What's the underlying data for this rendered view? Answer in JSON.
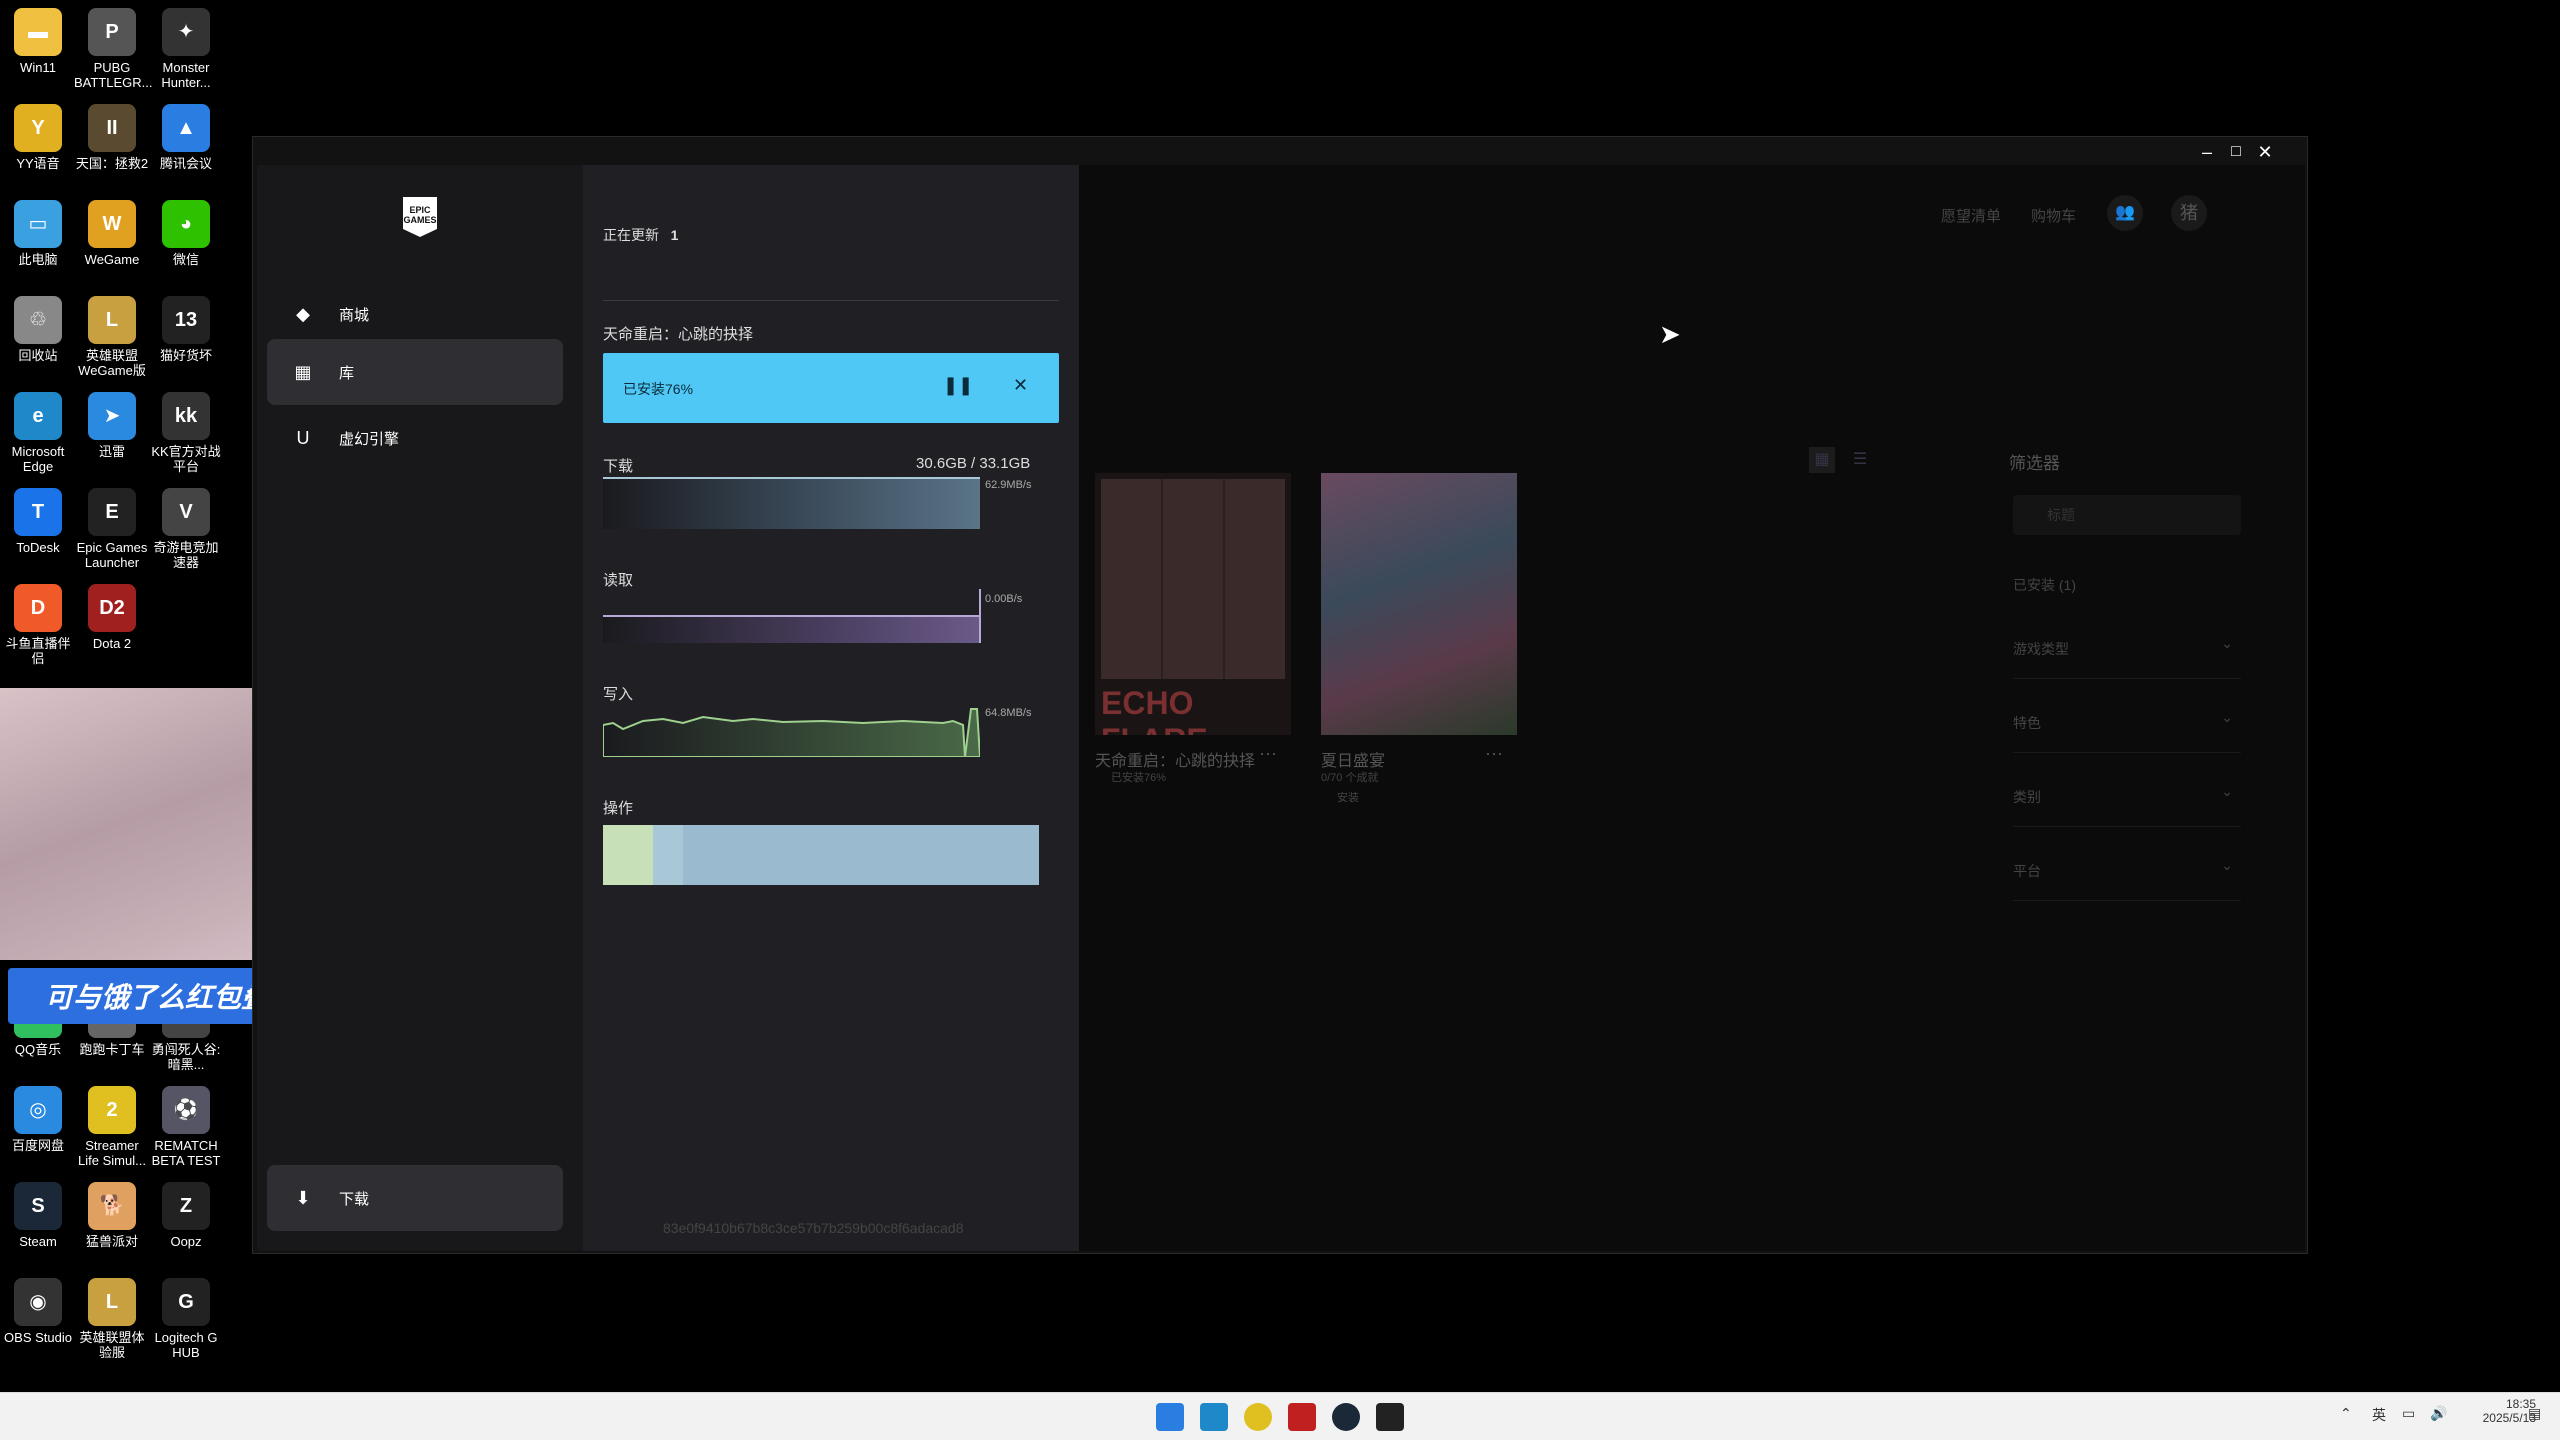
{
  "desktop": {
    "icons": [
      {
        "label": "Win11",
        "color": "#f0c040",
        "glyph": "▬"
      },
      {
        "label": "PUBG BATTLEGR...",
        "color": "#555",
        "glyph": "P"
      },
      {
        "label": "Monster Hunter...",
        "color": "#333",
        "glyph": "✦"
      },
      {
        "label": "YY语音",
        "color": "#e0b020",
        "glyph": "Y"
      },
      {
        "label": "天国：拯救2",
        "color": "#5a4a30",
        "glyph": "II"
      },
      {
        "label": "腾讯会议",
        "color": "#2a7de1",
        "glyph": "▲"
      },
      {
        "label": "此电脑",
        "color": "#3aa0e0",
        "glyph": "▭"
      },
      {
        "label": "WeGame",
        "color": "#e0a020",
        "glyph": "W"
      },
      {
        "label": "微信",
        "color": "#2dc100",
        "glyph": "◕"
      },
      {
        "label": "回收站",
        "color": "#888",
        "glyph": "♲"
      },
      {
        "label": "英雄联盟 WeGame版",
        "color": "#c8a040",
        "glyph": "L"
      },
      {
        "label": "猫好货坏",
        "color": "#222",
        "glyph": "13"
      },
      {
        "label": "Microsoft Edge",
        "color": "#1e88c8",
        "glyph": "e"
      },
      {
        "label": "迅雷",
        "color": "#2a8ae0",
        "glyph": "➤"
      },
      {
        "label": "KK官方对战平台",
        "color": "#333",
        "glyph": "kk"
      },
      {
        "label": "ToDesk",
        "color": "#1a73e8",
        "glyph": "T"
      },
      {
        "label": "Epic Games Launcher",
        "color": "#222",
        "glyph": "E"
      },
      {
        "label": "奇游电竞加速器",
        "color": "#444",
        "glyph": "V"
      },
      {
        "label": "斗鱼直播伴侣",
        "color": "#f05a28",
        "glyph": "D"
      },
      {
        "label": "Dota 2",
        "color": "#a02020",
        "glyph": "D2"
      },
      {
        "label": "QQ音乐",
        "color": "#30c060",
        "glyph": "♪"
      },
      {
        "label": "跑跑卡丁车",
        "color": "#666",
        "glyph": "K"
      },
      {
        "label": "勇闯死人谷: 暗黑...",
        "color": "#444",
        "glyph": "☠"
      },
      {
        "label": "百度网盘",
        "color": "#2a8ae0",
        "glyph": "◎"
      },
      {
        "label": "Streamer Life Simul...",
        "color": "#e0c020",
        "glyph": "2"
      },
      {
        "label": "REMATCH BETA TEST",
        "color": "#556",
        "glyph": "⚽"
      },
      {
        "label": "Steam",
        "color": "#1b2838",
        "glyph": "S"
      },
      {
        "label": "猛兽派对",
        "color": "#e0a060",
        "glyph": "🐕"
      },
      {
        "label": "Oopz",
        "color": "#222",
        "glyph": "Z"
      },
      {
        "label": "OBS Studio",
        "color": "#333",
        "glyph": "◉"
      },
      {
        "label": "英雄联盟体验服",
        "color": "#c8a040",
        "glyph": "L"
      },
      {
        "label": "Logitech G HUB",
        "color": "#222",
        "glyph": "G"
      }
    ]
  },
  "overlay": {
    "banner_text": "可与饿了么红包叠加使用"
  },
  "sidebar": {
    "logo": "EPIC GAMES",
    "items": [
      {
        "label": "商城",
        "icon": "tag-icon"
      },
      {
        "label": "库",
        "icon": "grid-icon"
      },
      {
        "label": "虚幻引擎",
        "icon": "unreal-icon"
      }
    ],
    "download_label": "下载"
  },
  "downloads": {
    "updating_label": "正在更新",
    "updating_count": "1",
    "game_title": "天命重启：心跳的抉择",
    "progress_label": "已安装76%",
    "progress": 0.76,
    "download_label": "下载",
    "download_size": "30.6GB / 33.1GB",
    "download_rate": "62.9MB/s",
    "read_label": "读取",
    "read_rate": "0.00B/s",
    "write_label": "写入",
    "write_rate": "64.8MB/s",
    "ops_label": "操作",
    "build_hash": "83e0f9410b67b8c3ce57b7b259b00c8f6adacad8"
  },
  "library": {
    "header_links": [
      "愿望清单",
      "购物车"
    ],
    "avatar": "猪",
    "filter_title": "筛选器",
    "search_placeholder": "标题",
    "installed_filter": "已安装 (1)",
    "filters": [
      "游戏类型",
      "特色",
      "类别",
      "平台"
    ],
    "games": [
      {
        "title": "天命重启：心跳的抉择",
        "status": "已安装76%",
        "cover_text": "ECHO FLARE"
      },
      {
        "title": "夏日盛宴",
        "status": "0/70 个成就",
        "action": "安装"
      }
    ]
  },
  "taskbar": {
    "lang": "英",
    "time": "18:35",
    "date": "2025/5/13"
  }
}
